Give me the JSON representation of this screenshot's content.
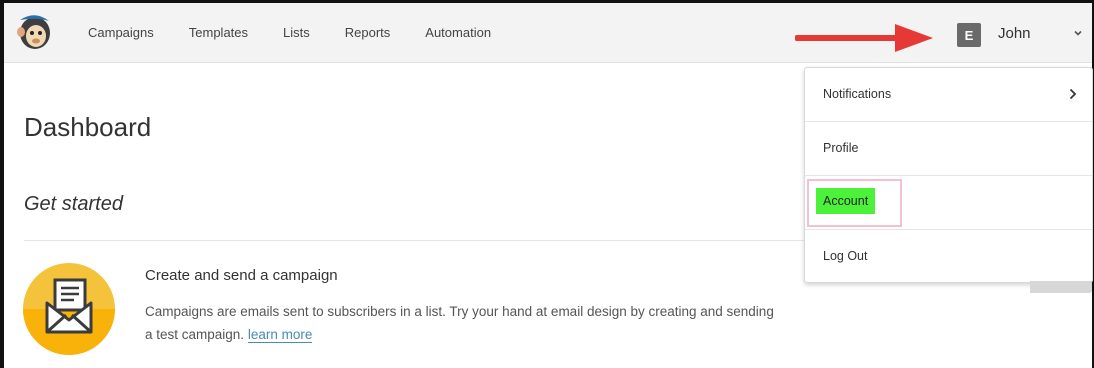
{
  "nav": {
    "items": [
      {
        "label": "Campaigns"
      },
      {
        "label": "Templates"
      },
      {
        "label": "Lists"
      },
      {
        "label": "Reports"
      },
      {
        "label": "Automation"
      }
    ]
  },
  "user": {
    "initial": "E",
    "name": "John"
  },
  "page": {
    "title": "Dashboard",
    "section_title": "Get started"
  },
  "campaign_card": {
    "title": "Create and send a campaign",
    "description": "Campaigns are emails sent to subscribers in a list. Try your hand at email design by creating and sending a test campaign.",
    "link_text": "learn more"
  },
  "dropdown": {
    "items": [
      {
        "label": "Notifications",
        "has_submenu": true
      },
      {
        "label": "Profile"
      },
      {
        "label": "Account",
        "highlighted": true
      },
      {
        "label": "Log Out"
      }
    ]
  },
  "colors": {
    "annotation_arrow": "#e53935",
    "highlight_fill": "#4cf23a",
    "highlight_border": "#f2c2d4",
    "link": "#4a8bb3",
    "campaign_icon_bg": "#f5c33b"
  }
}
